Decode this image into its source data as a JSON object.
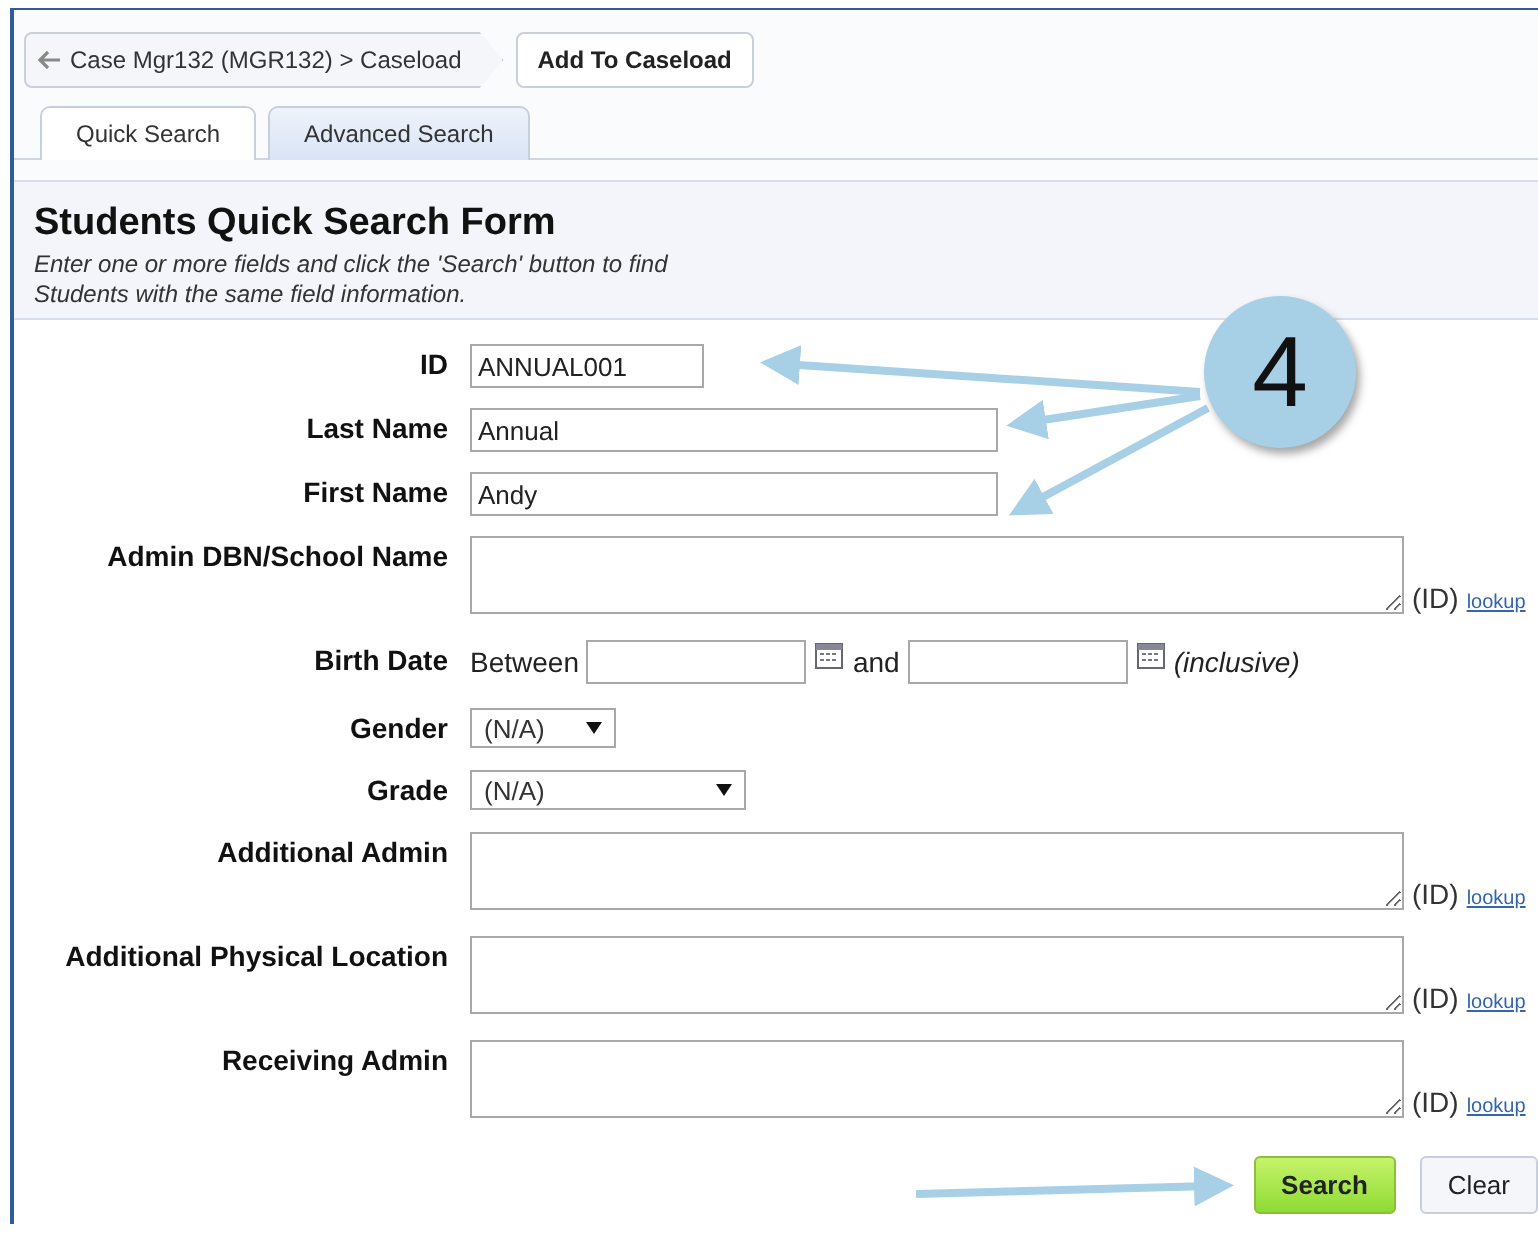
{
  "breadcrumb": {
    "back": "Case Mgr132 (MGR132) > Caseload",
    "action": "Add To Caseload"
  },
  "tabs": [
    {
      "label": "Quick Search",
      "selected": true
    },
    {
      "label": "Advanced Search",
      "selected": false
    }
  ],
  "form": {
    "title": "Students Quick Search Form",
    "hint": "Enter one or more fields and click the 'Search' button to find Students with the same field information.",
    "fields": [
      {
        "kind": "text",
        "label": "ID",
        "value": "ANNUAL001"
      },
      {
        "kind": "text",
        "label": "Last Name",
        "value": "Annual"
      },
      {
        "kind": "text",
        "label": "First Name",
        "value": "Andy"
      },
      {
        "kind": "area",
        "label": "Admin DBN/School Name",
        "suffix": "(ID)",
        "link": "lookup"
      },
      {
        "kind": "range",
        "label": "Birth Date",
        "before": "Between",
        "middle": "and",
        "after": "(inclusive)"
      },
      {
        "kind": "select",
        "label": "Gender",
        "value": "(N/A)"
      },
      {
        "kind": "select",
        "label": "Grade",
        "value": "(N/A)"
      },
      {
        "kind": "area",
        "label": "Additional Admin",
        "suffix": "(ID)",
        "link": "lookup"
      },
      {
        "kind": "area",
        "label": "Additional Physical Location",
        "suffix": "(ID)",
        "link": "lookup"
      },
      {
        "kind": "area",
        "label": "Receiving Admin",
        "suffix": "(ID)",
        "link": "lookup"
      }
    ],
    "buttons": [
      {
        "label": "Search",
        "primary": true
      },
      {
        "label": "Clear",
        "primary": false
      }
    ]
  },
  "callout": {
    "number": "4"
  }
}
